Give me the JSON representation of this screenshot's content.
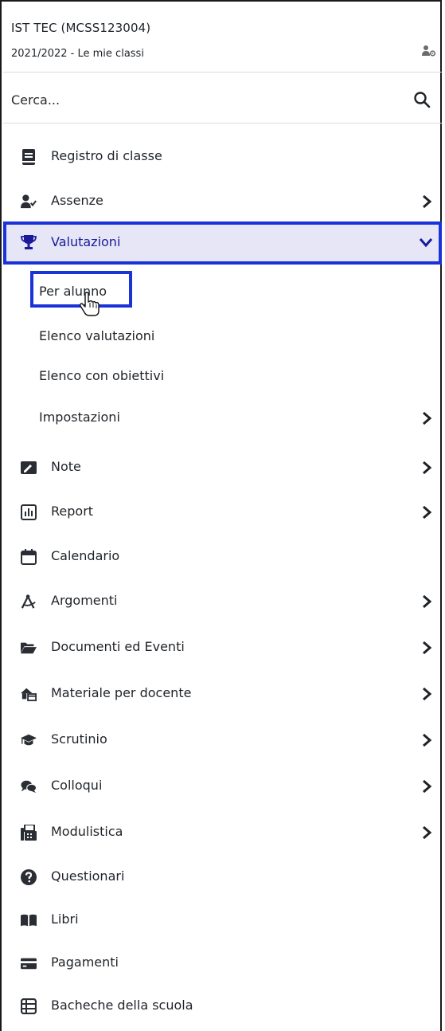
{
  "header": {
    "school": "IST TEC (MCSS123004)",
    "year": "2021/2022 - Le mie classi",
    "profile_icon": "user-gear-icon"
  },
  "search": {
    "placeholder": "Cerca...",
    "icon": "search-icon"
  },
  "menu": [
    {
      "label": "Registro di classe",
      "icon": "book-icon",
      "has_submenu": false
    },
    {
      "label": "Assenze",
      "icon": "user-check-icon",
      "has_submenu": true
    },
    {
      "label": "Valutazioni",
      "icon": "trophy-icon",
      "has_submenu": true,
      "expanded": true,
      "children": [
        {
          "label": "Per alunno"
        },
        {
          "label": "Elenco valutazioni"
        },
        {
          "label": "Elenco con obiettivi"
        },
        {
          "label": "Impostazioni",
          "has_submenu": true
        }
      ]
    },
    {
      "label": "Note",
      "icon": "note-icon",
      "has_submenu": true
    },
    {
      "label": "Report",
      "icon": "report-chart-icon",
      "has_submenu": true
    },
    {
      "label": "Calendario",
      "icon": "calendar-icon",
      "has_submenu": false
    },
    {
      "label": "Argomenti",
      "icon": "compass-icon",
      "has_submenu": true
    },
    {
      "label": "Documenti ed Eventi",
      "icon": "folder-open-icon",
      "has_submenu": true
    },
    {
      "label": "Materiale per docente",
      "icon": "home-box-icon",
      "has_submenu": true
    },
    {
      "label": "Scrutinio",
      "icon": "graduation-cap-icon",
      "has_submenu": true
    },
    {
      "label": "Colloqui",
      "icon": "chat-bubbles-icon",
      "has_submenu": true
    },
    {
      "label": "Modulistica",
      "icon": "fax-icon",
      "has_submenu": true
    },
    {
      "label": "Questionari",
      "icon": "question-circle-icon",
      "has_submenu": false
    },
    {
      "label": "Libri",
      "icon": "open-book-icon",
      "has_submenu": false
    },
    {
      "label": "Pagamenti",
      "icon": "credit-card-icon",
      "has_submenu": false
    },
    {
      "label": "Bacheche della scuola",
      "icon": "board-list-icon",
      "has_submenu": false
    }
  ],
  "colors": {
    "accent": "#1a33d9",
    "selected_bg": "#e6e6f7",
    "selected_text": "#1a1a9a"
  }
}
